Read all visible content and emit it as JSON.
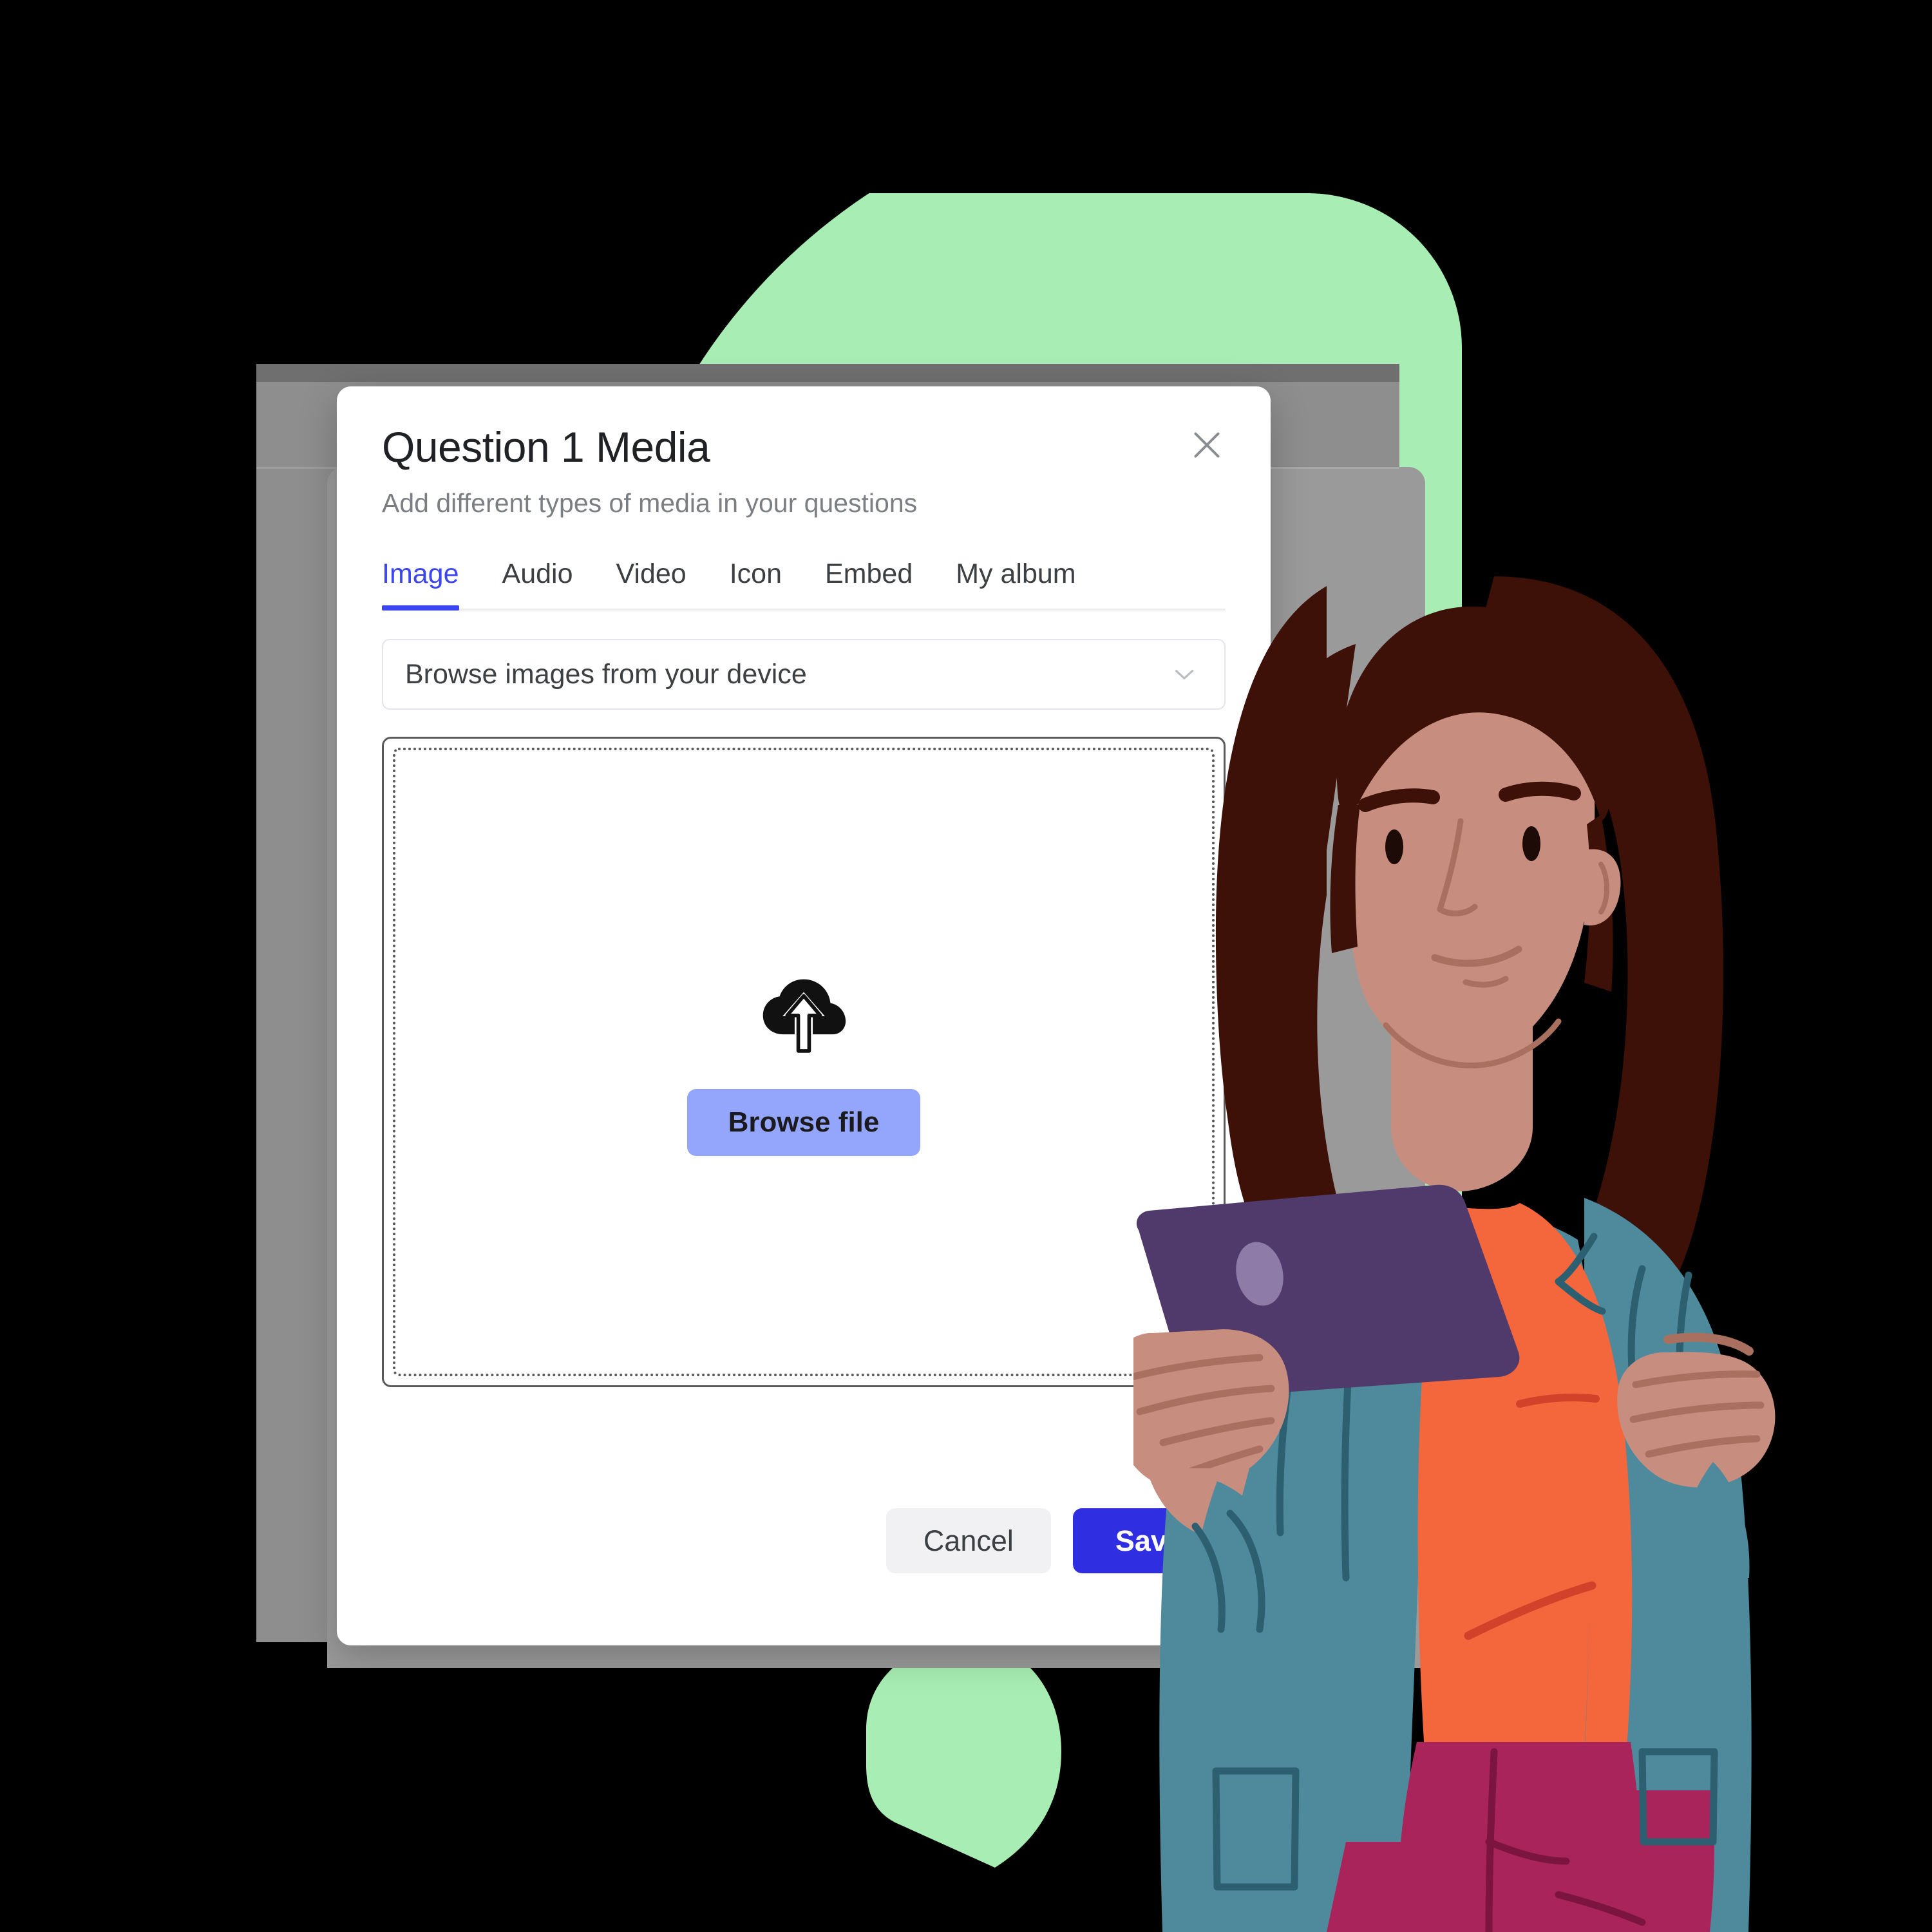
{
  "dialog": {
    "title": "Question 1 Media",
    "subtitle": "Add different types of media in your questions",
    "close_icon": "close-icon",
    "tabs": [
      {
        "label": "Image",
        "active": true
      },
      {
        "label": "Audio",
        "active": false
      },
      {
        "label": "Video",
        "active": false
      },
      {
        "label": "Icon",
        "active": false
      },
      {
        "label": "Embed",
        "active": false
      },
      {
        "label": "My album",
        "active": false
      }
    ],
    "source_select": {
      "value": "Browse images from your device",
      "icon": "chevron-down-icon"
    },
    "dropzone": {
      "icon": "cloud-upload-icon",
      "browse_label": "Browse file"
    },
    "footer": {
      "cancel_label": "Cancel",
      "save_label": "Save"
    }
  },
  "colors": {
    "accent_blue": "#3b46f1",
    "save_blue": "#2f2ee0",
    "browse_button": "#94a6fb",
    "cancel_gray": "#f1f1f3",
    "page_background": "#000000",
    "mint_green": "#a8eeb4",
    "backdrop_gray": "#8e8e8e",
    "backdrop_gray_dark": "#6f6f6f",
    "dialog_white": "#ffffff",
    "title_text": "#202124",
    "subtitle_text": "#7b7f84",
    "illustration_skin": "#c78e80",
    "illustration_hair": "#3d1008",
    "illustration_jacket": "#4f8a9c",
    "illustration_jacket_line": "#2c6070",
    "illustration_shirt": "#f4663c",
    "illustration_shirt_line": "#d2412a",
    "illustration_pants": "#a9245b",
    "illustration_pants_line": "#7b1540",
    "illustration_tablet": "#50396b",
    "illustration_tablet_lens": "#8e7ba8"
  },
  "decor": {
    "green_circle_large": "mint-circle-large",
    "green_circle_left": "mint-circle-left",
    "green_dot_top": "mint-dot-top",
    "green_blob_bottom": "mint-blob-bottom",
    "device_frame": "device-frame",
    "device_camera_dot": "device-camera-dot"
  },
  "illustration": {
    "name": "woman-holding-tablet"
  }
}
